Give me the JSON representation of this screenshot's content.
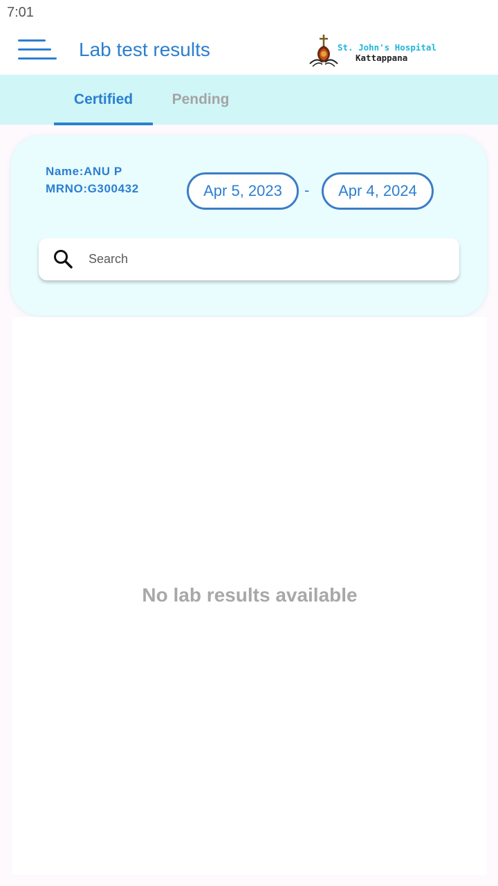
{
  "status_bar": {
    "time": "7:01"
  },
  "app_bar": {
    "title": "Lab test results",
    "menu_icon": "hamburger-menu-icon",
    "logo": {
      "name": "St. John's Hospital",
      "place": "Kattappana"
    }
  },
  "tabs": [
    {
      "label": "Certified",
      "selected": true
    },
    {
      "label": "Pending",
      "selected": false
    }
  ],
  "patient": {
    "name_line": "Name:ANU P",
    "mrno_line": "MRNO:G300432"
  },
  "date_range": {
    "from": "Apr 5, 2023",
    "separator": "-",
    "to": "Apr 4, 2024"
  },
  "search": {
    "placeholder": "Search",
    "value": "",
    "icon": "search-icon"
  },
  "results": {
    "empty_message": "No lab results available"
  },
  "colors": {
    "primary": "#2b7fd0",
    "tab_bar_bg": "#d0f6f8",
    "card_bg": "#e9fcfe",
    "inactive_tab": "#a4a4a4",
    "logo_cyan": "#20b6d8",
    "empty_text": "#a8a8a8"
  }
}
